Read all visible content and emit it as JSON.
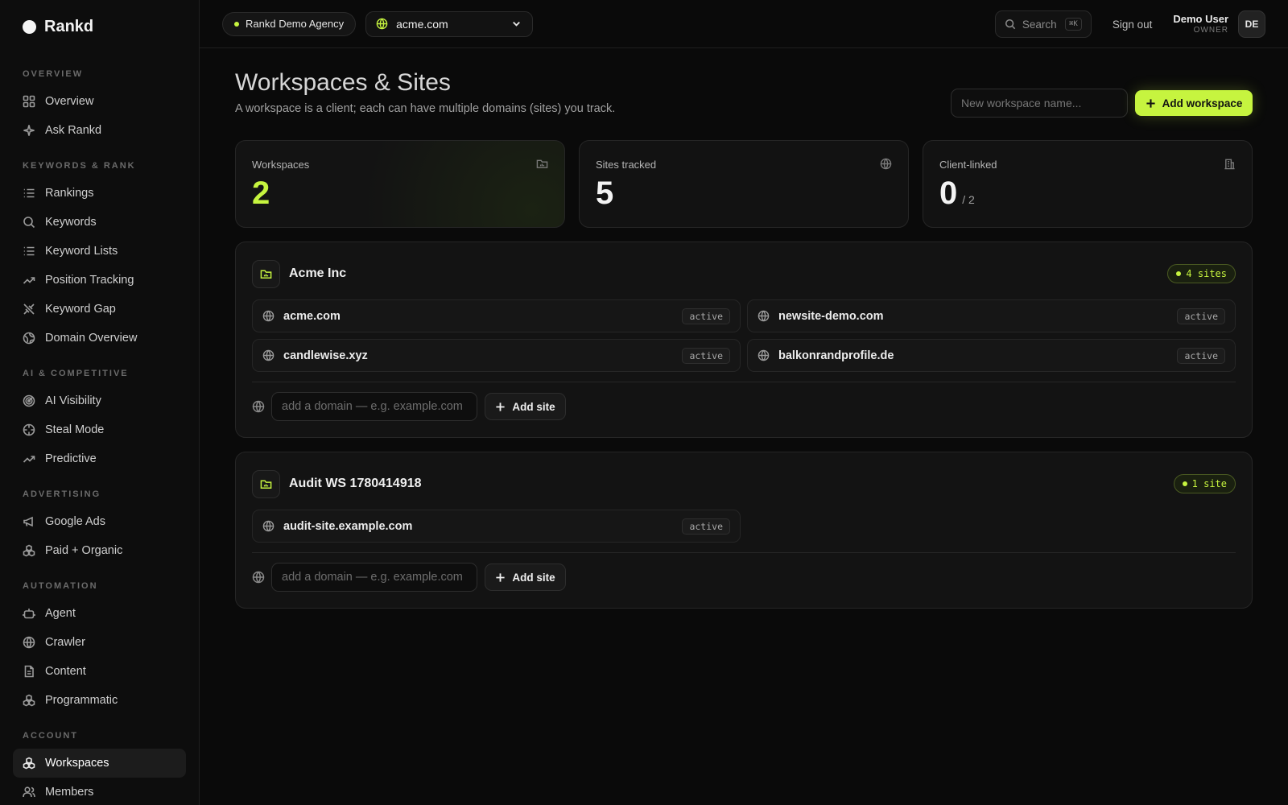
{
  "brand": {
    "name": "Rankd"
  },
  "sidebar": {
    "sections": [
      {
        "title": "OVERVIEW",
        "items": [
          {
            "label": "Overview",
            "icon": "grid-icon"
          },
          {
            "label": "Ask Rankd",
            "icon": "sparkle-icon"
          }
        ]
      },
      {
        "title": "KEYWORDS & RANK",
        "items": [
          {
            "label": "Rankings",
            "icon": "list-icon"
          },
          {
            "label": "Keywords",
            "icon": "search-icon"
          },
          {
            "label": "Keyword Lists",
            "icon": "list-icon"
          },
          {
            "label": "Position Tracking",
            "icon": "trend-icon"
          },
          {
            "label": "Keyword Gap",
            "icon": "gap-icon"
          },
          {
            "label": "Domain Overview",
            "icon": "globe-icon"
          }
        ]
      },
      {
        "title": "AI & COMPETITIVE",
        "items": [
          {
            "label": "AI Visibility",
            "icon": "radar-icon"
          },
          {
            "label": "Steal Mode",
            "icon": "crosshair-icon"
          },
          {
            "label": "Predictive",
            "icon": "trend-icon"
          }
        ]
      },
      {
        "title": "ADVERTISING",
        "items": [
          {
            "label": "Google Ads",
            "icon": "megaphone-icon"
          },
          {
            "label": "Paid + Organic",
            "icon": "boxes-icon"
          }
        ]
      },
      {
        "title": "AUTOMATION",
        "items": [
          {
            "label": "Agent",
            "icon": "bot-icon"
          },
          {
            "label": "Crawler",
            "icon": "globe-icon"
          },
          {
            "label": "Content",
            "icon": "document-icon"
          },
          {
            "label": "Programmatic",
            "icon": "boxes-icon"
          }
        ]
      },
      {
        "title": "ACCOUNT",
        "items": [
          {
            "label": "Workspaces",
            "icon": "boxes-icon",
            "active": true
          },
          {
            "label": "Members",
            "icon": "users-icon"
          }
        ]
      }
    ]
  },
  "topbar": {
    "agency": "Rankd Demo Agency",
    "domain": "acme.com",
    "search_label": "Search",
    "search_kbd": "⌘K",
    "sign_out": "Sign out",
    "user_name": "Demo User",
    "user_role": "OWNER",
    "avatar": "DE"
  },
  "page": {
    "title": "Workspaces & Sites",
    "subtitle": "A workspace is a client; each can have multiple domains (sites) you track.",
    "new_workspace_placeholder": "New workspace name...",
    "add_workspace_label": "Add workspace"
  },
  "stats": {
    "workspaces": {
      "label": "Workspaces",
      "value": "2"
    },
    "sites": {
      "label": "Sites tracked",
      "value": "5"
    },
    "client_linked": {
      "label": "Client-linked",
      "value": "0",
      "of": "/ 2"
    }
  },
  "workspaces": [
    {
      "name": "Acme Inc",
      "badge": "4 sites",
      "sites": [
        {
          "domain": "acme.com",
          "status": "active"
        },
        {
          "domain": "newsite-demo.com",
          "status": "active"
        },
        {
          "domain": "candlewise.xyz",
          "status": "active"
        },
        {
          "domain": "balkonrandprofile.de",
          "status": "active"
        }
      ],
      "domain_placeholder": "add a domain — e.g. example.com",
      "add_site_label": "Add site"
    },
    {
      "name": "Audit WS 1780414918",
      "badge": "1 site",
      "sites": [
        {
          "domain": "audit-site.example.com",
          "status": "active"
        }
      ],
      "domain_placeholder": "add a domain — e.g. example.com",
      "add_site_label": "Add site"
    }
  ],
  "colors": {
    "accent": "#c6f43f",
    "background": "#0a0a0a"
  }
}
